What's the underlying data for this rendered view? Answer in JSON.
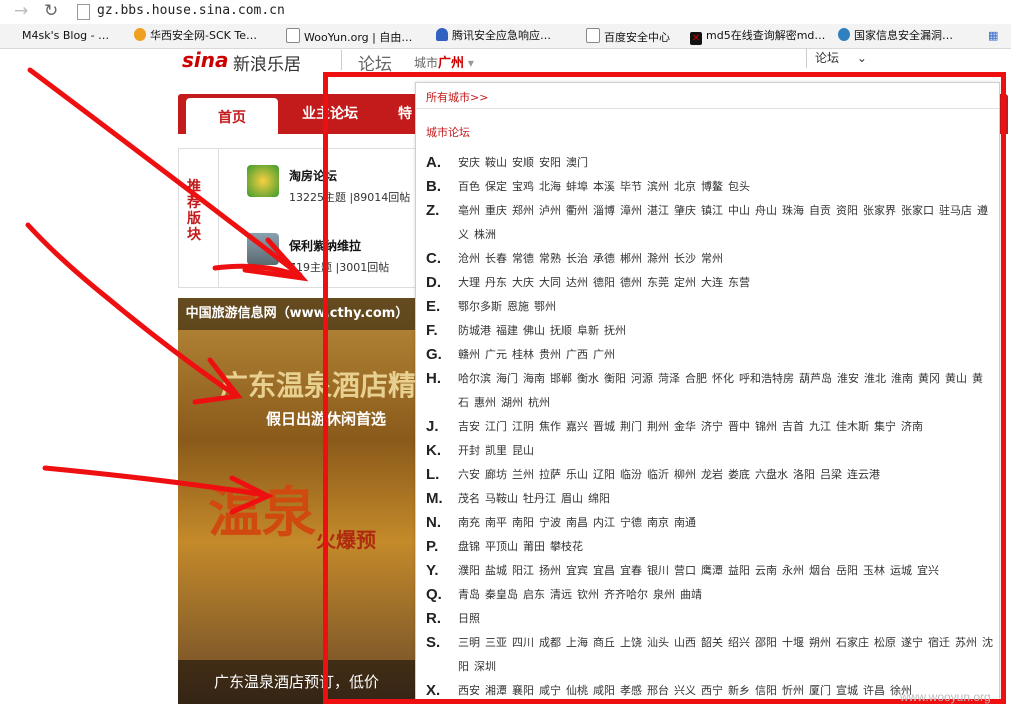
{
  "browser": {
    "url": "gz.bbs.house.sina.com.cn",
    "bookmarks": [
      {
        "label": "M4sk's Blog - …",
        "color": "#444"
      },
      {
        "label": "华西安全网-SCK Te…",
        "color": "#f0a020"
      },
      {
        "label": "WooYun.org | 自由…",
        "color": "#fff"
      },
      {
        "label": "腾讯安全应急响应…",
        "color": "#3060c0"
      },
      {
        "label": "百度安全中心",
        "color": "#fff"
      },
      {
        "label": "md5在线查询解密md…",
        "color": "#c00"
      },
      {
        "label": "国家信息安全漏洞…",
        "color": "#3080c0"
      }
    ]
  },
  "header": {
    "logo": "sina",
    "logo_sub": "新浪乐居",
    "section": "论坛",
    "city_label": "城市",
    "city_value": "广州",
    "search_label": "论坛"
  },
  "tabs": [
    "首页",
    "业主论坛",
    "特"
  ],
  "recommend": {
    "label": "推荐版块",
    "items": [
      {
        "title": "淘房论坛",
        "stats": "13225主题 |89014回帖"
      },
      {
        "title": "保利紫纳维拉",
        "stats": "719主题 |3001回帖"
      }
    ]
  },
  "banner": {
    "top": "中国旅游信息网（www.cthy.com）",
    "big": "广东温泉酒店精",
    "sub": "假日出游休闲首选",
    "quan": "温泉",
    "bao": "火爆预",
    "footer": "广东温泉酒店预订，低价"
  },
  "popup": {
    "all_cities": "所有城市>>",
    "city_forum": "城市论坛",
    "rows": [
      {
        "letter": "A.",
        "cities": [
          "安庆",
          "鞍山",
          "安顺",
          "安阳",
          "澳门"
        ]
      },
      {
        "letter": "B.",
        "cities": [
          "百色",
          "保定",
          "宝鸡",
          "北海",
          "蚌埠",
          "本溪",
          "毕节",
          "滨州",
          "北京",
          "博鳌",
          "包头"
        ]
      },
      {
        "letter": "Z.",
        "cities": [
          "亳州",
          "重庆",
          "郑州",
          "泸州",
          "衢州",
          "淄博",
          "漳州",
          "湛江",
          "肇庆",
          "镇江",
          "中山",
          "舟山",
          "珠海",
          "自贡",
          "资阳",
          "张家界",
          "张家口",
          "驻马店",
          "遵义",
          "株洲"
        ]
      },
      {
        "letter": "C.",
        "cities": [
          "沧州",
          "长春",
          "常德",
          "常熟",
          "长治",
          "承德",
          "郴州",
          "滁州",
          "长沙",
          "常州"
        ]
      },
      {
        "letter": "D.",
        "cities": [
          "大理",
          "丹东",
          "大庆",
          "大同",
          "达州",
          "德阳",
          "德州",
          "东莞",
          "定州",
          "大连",
          "东营"
        ]
      },
      {
        "letter": "E.",
        "cities": [
          "鄂尔多斯",
          "恩施",
          "鄂州"
        ]
      },
      {
        "letter": "F.",
        "cities": [
          "防城港",
          "福建",
          "佛山",
          "抚顺",
          "阜新",
          "抚州"
        ]
      },
      {
        "letter": "G.",
        "cities": [
          "赣州",
          "广元",
          "桂林",
          "贵州",
          "广西",
          "广州"
        ]
      },
      {
        "letter": "H.",
        "cities": [
          "哈尔滨",
          "海门",
          "海南",
          "邯郸",
          "衡水",
          "衡阳",
          "河源",
          "菏泽",
          "合肥",
          "怀化",
          "呼和浩特房",
          "葫芦岛",
          "淮安",
          "淮北",
          "淮南",
          "黄冈",
          "黄山",
          "黄石",
          "惠州",
          "湖州",
          "杭州"
        ]
      },
      {
        "letter": "J.",
        "cities": [
          "吉安",
          "江门",
          "江阴",
          "焦作",
          "嘉兴",
          "晋城",
          "荆门",
          "荆州",
          "金华",
          "济宁",
          "晋中",
          "锦州",
          "吉首",
          "九江",
          "佳木斯",
          "集宁",
          "济南"
        ]
      },
      {
        "letter": "K.",
        "cities": [
          "开封",
          "凯里",
          "昆山"
        ]
      },
      {
        "letter": "L.",
        "cities": [
          "六安",
          "廊坊",
          "兰州",
          "拉萨",
          "乐山",
          "辽阳",
          "临汾",
          "临沂",
          "柳州",
          "龙岩",
          "娄底",
          "六盘水",
          "洛阳",
          "吕梁",
          "连云港"
        ]
      },
      {
        "letter": "M.",
        "cities": [
          "茂名",
          "马鞍山",
          "牡丹江",
          "眉山",
          "绵阳"
        ]
      },
      {
        "letter": "N.",
        "cities": [
          "南充",
          "南平",
          "南阳",
          "宁波",
          "南昌",
          "内江",
          "宁德",
          "南京",
          "南通"
        ]
      },
      {
        "letter": "P.",
        "cities": [
          "盘锦",
          "平顶山",
          "莆田",
          "攀枝花"
        ]
      },
      {
        "letter": "Y.",
        "cities": [
          "濮阳",
          "盐城",
          "阳江",
          "扬州",
          "宜宾",
          "宜昌",
          "宜春",
          "银川",
          "营口",
          "鹰潭",
          "益阳",
          "云南",
          "永州",
          "烟台",
          "岳阳",
          "玉林",
          "运城",
          "宜兴"
        ]
      },
      {
        "letter": "Q.",
        "cities": [
          "青岛",
          "秦皇岛",
          "启东",
          "清远",
          "钦州",
          "齐齐哈尔",
          "泉州",
          "曲靖"
        ]
      },
      {
        "letter": "R.",
        "cities": [
          "日照"
        ]
      },
      {
        "letter": "S.",
        "cities": [
          "三明",
          "三亚",
          "四川",
          "成都",
          "上海",
          "商丘",
          "上饶",
          "汕头",
          "山西",
          "韶关",
          "绍兴",
          "邵阳",
          "十堰",
          "朔州",
          "石家庄",
          "松原",
          "遂宁",
          "宿迁",
          "苏州",
          "沈阳",
          "深圳"
        ]
      },
      {
        "letter": "X.",
        "cities": [
          "西安",
          "湘潭",
          "襄阳",
          "咸宁",
          "仙桃",
          "咸阳",
          "孝感",
          "邢台",
          "兴义",
          "西宁",
          "新乡",
          "信阳",
          "忻州",
          "厦门",
          "宣城",
          "许昌",
          "徐州"
        ]
      }
    ]
  },
  "watermark": "www.wooyun.org",
  "colors": {
    "brand_red": "#c31b1b",
    "annotation_red": "#ee1010"
  }
}
